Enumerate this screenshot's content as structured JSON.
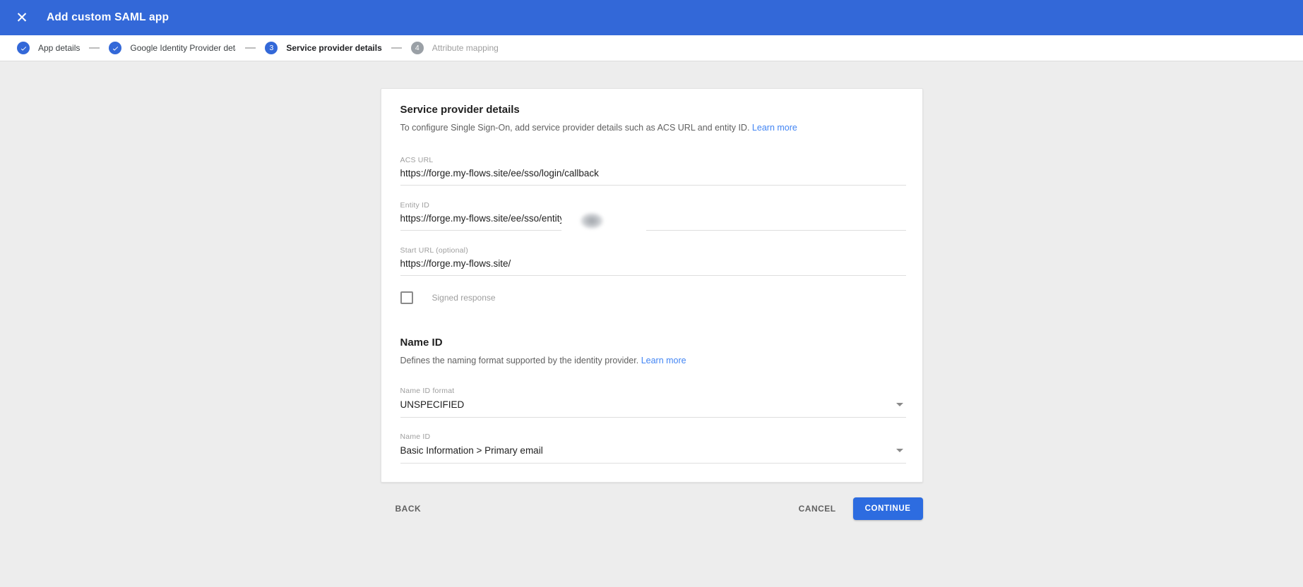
{
  "app_bar": {
    "title": "Add custom SAML app"
  },
  "stepper": {
    "steps": [
      {
        "label": "App details",
        "state": "completed"
      },
      {
        "label": "Google Identity Provider details",
        "state": "completed"
      },
      {
        "label": "Service provider details",
        "state": "active",
        "number": "3"
      },
      {
        "label": "Attribute mapping",
        "state": "upcoming",
        "number": "4"
      }
    ]
  },
  "service_provider": {
    "title": "Service provider details",
    "description": "To configure Single Sign-On, add service provider details such as ACS URL and entity ID.",
    "learn_more": "Learn more",
    "fields": [
      {
        "label": "ACS URL",
        "value": "https://forge.my-flows.site/ee/sso/login/callback"
      },
      {
        "label": "Entity ID",
        "value": "https://forge.my-flows.site/ee/sso/entity",
        "redacted": true
      },
      {
        "label": "Start URL (optional)",
        "value": "https://forge.my-flows.site/"
      }
    ],
    "checkbox": {
      "label": "Signed response",
      "checked": false
    }
  },
  "name_id": {
    "title": "Name ID",
    "description": "Defines the naming format supported by the identity provider.",
    "learn_more": "Learn more",
    "dropdowns": [
      {
        "label": "Name ID format",
        "value": "UNSPECIFIED"
      },
      {
        "label": "Name ID",
        "value": "Basic Information > Primary email"
      }
    ]
  },
  "footer": {
    "back": "BACK",
    "cancel": "CANCEL",
    "continue": "CONTINUE"
  },
  "colors": {
    "app_bar_blue": "#3368d8",
    "primary_button_blue": "#2d6ce0",
    "link_blue": "#4285f4",
    "inactive_step_gray": "#9aa0a6",
    "page_background": "#ededed"
  }
}
